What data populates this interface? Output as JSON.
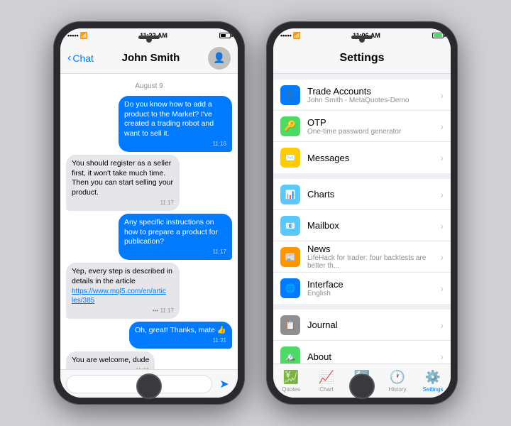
{
  "background": "#d0d0d5",
  "left_phone": {
    "status": {
      "signal": "•••••",
      "wifi": "wifi",
      "time": "11:22 AM",
      "battery": "low"
    },
    "nav": {
      "back_label": "Chat",
      "title": "John Smith"
    },
    "date_divider": "August 9",
    "messages": [
      {
        "id": 1,
        "side": "right",
        "text": "Do you know how to add a product to the Market? I've created a trading robot and want to sell it.",
        "time": "11:16"
      },
      {
        "id": 2,
        "side": "left",
        "text": "You should register as a seller first, it won't take much time. Then you can start selling your product.",
        "time": "11:17"
      },
      {
        "id": 3,
        "side": "right",
        "text": "Any specific instructions on how to prepare a product for publication?",
        "time": "11:17"
      },
      {
        "id": 4,
        "side": "left",
        "text": "Yep, every step is described in details in the article https://www.mql5.com/en/articles/385",
        "time": "••• 11:17",
        "has_link": true,
        "link_text": "https://www.mql5.com/en/artic les/385"
      },
      {
        "id": 5,
        "side": "right",
        "text": "Oh, great! Thanks, mate 👍",
        "time": "11:21"
      },
      {
        "id": 6,
        "side": "left",
        "text": "You are welcome, dude",
        "time": "11:21"
      }
    ],
    "input_placeholder": "",
    "send_icon": "➤"
  },
  "right_phone": {
    "status": {
      "signal": "•••••",
      "wifi": "wifi",
      "time": "11:06 AM",
      "battery": "full"
    },
    "nav": {
      "title": "Settings"
    },
    "sections": [
      {
        "rows": [
          {
            "icon": "👤",
            "icon_color": "ic-blue",
            "label": "Trade Accounts",
            "sublabel": "John Smith - MetaQuotes-Demo",
            "chevron": true
          },
          {
            "icon": "🔑",
            "icon_color": "ic-green",
            "label": "OTP",
            "sublabel": "One-time password generator",
            "chevron": true
          },
          {
            "icon": "✉️",
            "icon_color": "ic-yellow",
            "label": "Messages",
            "sublabel": "",
            "chevron": true
          }
        ]
      },
      {
        "rows": [
          {
            "icon": "📊",
            "icon_color": "ic-teal",
            "label": "Charts",
            "sublabel": "",
            "chevron": true
          },
          {
            "icon": "📧",
            "icon_color": "ic-teal",
            "label": "Mailbox",
            "sublabel": "",
            "chevron": true
          },
          {
            "icon": "📰",
            "icon_color": "ic-orange",
            "label": "News",
            "sublabel": "LifeHack for trader: four backtests are better th...",
            "chevron": true
          },
          {
            "icon": "🌐",
            "icon_color": "ic-blue",
            "label": "Interface",
            "sublabel": "English",
            "chevron": true
          }
        ]
      },
      {
        "rows": [
          {
            "icon": "📋",
            "icon_color": "ic-gray",
            "label": "Journal",
            "sublabel": "",
            "chevron": true
          },
          {
            "icon": "🏔️",
            "icon_color": "ic-green",
            "label": "About",
            "sublabel": "",
            "chevron": true
          }
        ]
      }
    ],
    "tabs": [
      {
        "icon": "💹",
        "label": "Quotes",
        "active": false
      },
      {
        "icon": "📈",
        "label": "Chart",
        "active": false
      },
      {
        "icon": "🔄",
        "label": "Trade",
        "active": false
      },
      {
        "icon": "🕐",
        "label": "History",
        "active": false
      },
      {
        "icon": "⚙️",
        "label": "Settings",
        "active": true
      }
    ]
  }
}
